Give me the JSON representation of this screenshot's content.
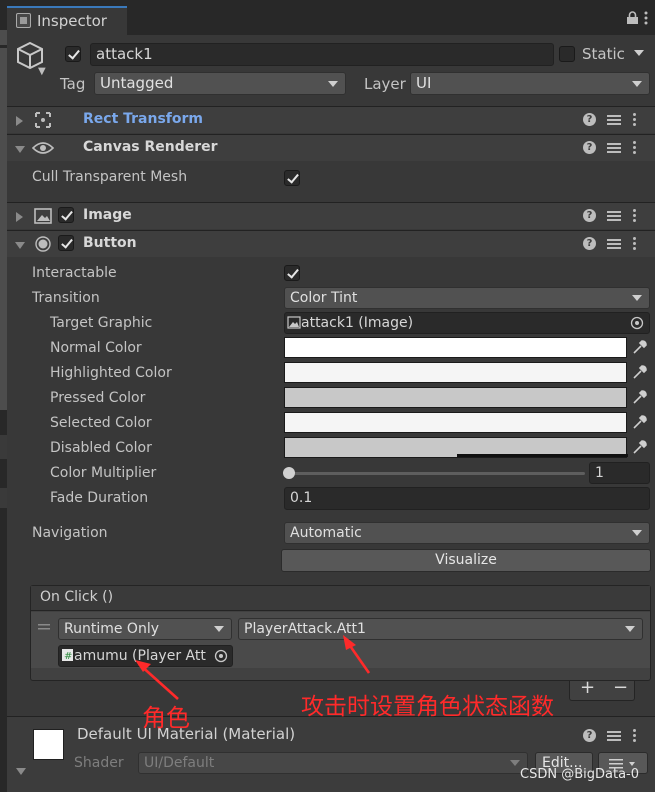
{
  "tab": {
    "title": "Inspector"
  },
  "header": {
    "object_name": "attack1",
    "active": true,
    "static_label": "Static",
    "tag_label": "Tag",
    "tag_value": "Untagged",
    "layer_label": "Layer",
    "layer_value": "UI"
  },
  "components": {
    "rect_transform": {
      "title": "Rect Transform"
    },
    "canvas_renderer": {
      "title": "Canvas Renderer",
      "cull_label": "Cull Transparent Mesh",
      "cull_value": true
    },
    "image": {
      "title": "Image",
      "enabled": true
    },
    "button": {
      "title": "Button",
      "enabled": true,
      "interactable_label": "Interactable",
      "transition_label": "Transition",
      "transition_value": "Color Tint",
      "target_graphic_label": "Target Graphic",
      "target_graphic_value": "attack1 (Image)",
      "normal_color_label": "Normal Color",
      "highlighted_color_label": "Highlighted Color",
      "pressed_color_label": "Pressed Color",
      "selected_color_label": "Selected Color",
      "disabled_color_label": "Disabled Color",
      "color_multiplier_label": "Color Multiplier",
      "color_multiplier_value": "1",
      "color_multiplier_level": 0,
      "fade_duration_label": "Fade Duration",
      "fade_duration_value": "0.1",
      "navigation_label": "Navigation",
      "navigation_value": "Automatic",
      "visualize_label": "Visualize",
      "colors": {
        "normal": "#ffffff",
        "highlighted": "#f5f5f5",
        "pressed": "#c8c8c8",
        "selected": "#f5f5f5",
        "disabled": "#c8c8c8"
      }
    },
    "on_click": {
      "title": "On Click ()",
      "runtime_value": "Runtime Only",
      "function_value": "PlayerAttack.Att1",
      "object_value": "amumu (Player Att",
      "add_label": "+",
      "remove_label": "−"
    },
    "material": {
      "name": "Default UI Material (Material)",
      "shader_label": "Shader",
      "shader_value": "UI/Default",
      "edit_label": "Edit..."
    }
  },
  "annotations": {
    "role": "角色",
    "note": "攻击时设置角色状态函数"
  },
  "watermark": "CSDN @BigData-0",
  "theme": {
    "accent": "#3a79bb",
    "link_blue": "#7aa8ec",
    "annotation_red": "#ff2a2a"
  }
}
